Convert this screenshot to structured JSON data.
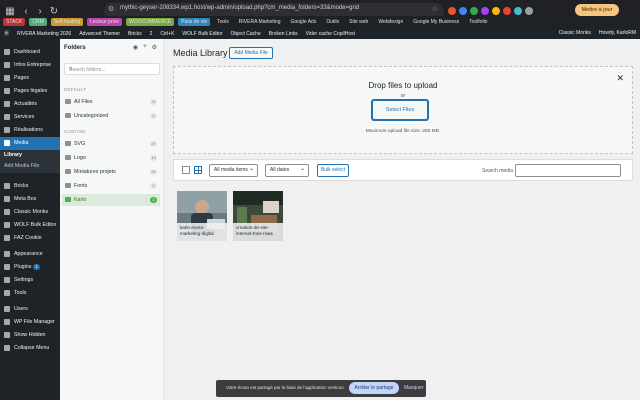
{
  "browser": {
    "url": "mythic-geyser-208334.wp1.host/wp-admin/upload.php?cm_media_folders=33&mode=grid",
    "update_label": "Mettre à jour",
    "bookmarks": [
      "STACK",
      "CRM",
      "Self-hosting",
      "Lecteur prive",
      "WOOCOMMERCE",
      "Pass de vie",
      "Tools",
      "RIVERA Marketing",
      "Google Ads",
      "Outils",
      "Site web",
      "Webdesign",
      "Google My Business",
      "Toolfolio"
    ],
    "extension_colors": [
      "#e8562a",
      "#4285f4",
      "#34a853",
      "#a142f4",
      "#fbbc05",
      "#ea4335",
      "#46bdc6",
      "#9aa0a6"
    ]
  },
  "adminbar": {
    "items": [
      "RIVERA Marketing 2026",
      "Advanced Themer",
      "Bricks",
      "2",
      "Ctrl+K",
      "WOLF Bulk Editor",
      "Object Cache",
      "Broken Links",
      "Vider cache CopilHost"
    ],
    "right_items": [
      "Classic Monks",
      "Howdy, KarloRM"
    ]
  },
  "sidebar": {
    "items": [
      {
        "label": "Dashboard",
        "icon": "dashboard-icon"
      },
      {
        "label": "Infos Entreprise",
        "icon": "gear-icon"
      },
      {
        "label": "Pages",
        "icon": "pages-icon"
      },
      {
        "label": "Pages légales",
        "icon": "pages-icon"
      },
      {
        "label": "Actualités",
        "icon": "pin-icon"
      },
      {
        "label": "Services",
        "icon": "pin-icon"
      },
      {
        "label": "Réalisations",
        "icon": "pin-icon"
      },
      {
        "label": "Media",
        "icon": "media-icon"
      },
      {
        "label": "Bricks",
        "icon": "bricks-icon"
      },
      {
        "label": "Meta Box",
        "icon": "box-icon"
      },
      {
        "label": "Classic Monks",
        "icon": "monks-icon"
      },
      {
        "label": "WOLF Bulk Editor",
        "icon": "wolf-icon"
      },
      {
        "label": "FAZ Cookie",
        "icon": "cookie-icon"
      },
      {
        "label": "Appearance",
        "icon": "brush-icon"
      },
      {
        "label": "Plugins",
        "icon": "plugin-icon",
        "badge": "1"
      },
      {
        "label": "Settings",
        "icon": "settings-icon"
      },
      {
        "label": "Tools",
        "icon": "tools-icon"
      },
      {
        "label": "Users",
        "icon": "users-icon"
      },
      {
        "label": "WP File Manager",
        "icon": "folder-icon"
      },
      {
        "label": "Show Hidden",
        "icon": "chevron-icon"
      },
      {
        "label": "Collapse Menu",
        "icon": "collapse-icon"
      }
    ],
    "submenu": [
      "Library",
      "Add Media File"
    ]
  },
  "folders": {
    "title": "Folders",
    "search_placeholder": "Search folders...",
    "default_label": "DEFAULT",
    "custom_label": "CUSTOM",
    "default_items": [
      {
        "label": "All Files",
        "count": "71"
      },
      {
        "label": "Uncategorized",
        "count": "0"
      }
    ],
    "custom_items": [
      {
        "label": "SVG",
        "count": "27"
      },
      {
        "label": "Logo",
        "count": "13"
      },
      {
        "label": "Miniatures projets",
        "count": "24"
      },
      {
        "label": "Fonts",
        "count": "0"
      },
      {
        "label": "Karlo",
        "count": "2"
      }
    ]
  },
  "main": {
    "title": "Media Library",
    "add_button": "Add Media File",
    "drop_title": "Drop files to upload",
    "drop_or": "or",
    "select_files": "Select Files",
    "max_size": "Maximum upload file size: 250 MB.",
    "filter_type": "All media items",
    "filter_date": "All dates",
    "bulk_select": "Bulk select",
    "search_label": "Search media"
  },
  "attachments": [
    {
      "caption": "karlo-rivera-marketing-digital"
    },
    {
      "caption": "creation-de-site-internet-trois-rivas"
    }
  ],
  "share": {
    "text": "Votre écran est partagé par le biais de l'application ventcoo.",
    "stop": "Arrêter le partage",
    "hide": "Masquer"
  }
}
